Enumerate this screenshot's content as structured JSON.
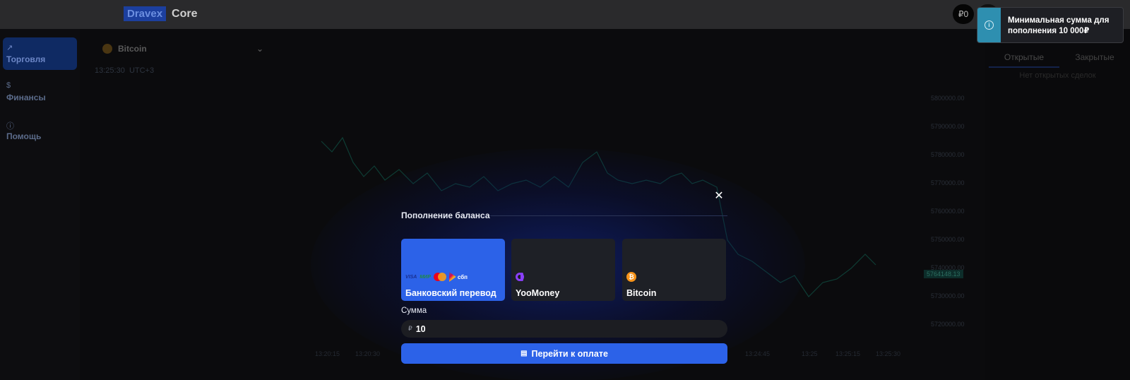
{
  "app": {
    "logo_mark": "Dravex",
    "logo_name": "Core",
    "balance": "₽0"
  },
  "sidebar": {
    "items": [
      {
        "label": "Торговля",
        "icon": "chart-line-icon",
        "active": true
      },
      {
        "label": "Финансы",
        "icon": "dollar-icon",
        "active": false
      },
      {
        "label": "Помощь",
        "icon": "info-icon",
        "active": false
      }
    ]
  },
  "chart_header": {
    "asset": "Bitcoin",
    "time": "13:25:30",
    "timezone": "UTC+3"
  },
  "chart": {
    "price_tag": "5764148.13",
    "y_ticks": [
      "5800000.00",
      "5790000.00",
      "5780000.00",
      "5770000.00",
      "5760000.00",
      "5750000.00",
      "5740000.00",
      "5730000.00",
      "5720000.00"
    ],
    "x_ticks": [
      "13:20:15",
      "13:20:30",
      "13:24:45",
      "13:25",
      "13:25:15",
      "13:25:30"
    ]
  },
  "right_panel": {
    "tabs": [
      "Открытые",
      "Закрытые"
    ],
    "empty_text": "Нет открытых сделок"
  },
  "modal": {
    "title": "Пополнение баланса",
    "close_icon": "close-icon",
    "methods": [
      {
        "label": "Банковский перевод",
        "active": true,
        "logos": [
          "VISA",
          "МИР",
          "mastercard",
          "сбп"
        ]
      },
      {
        "label": "YooMoney",
        "active": false,
        "logos": [
          "yoomoney"
        ]
      },
      {
        "label": "Bitcoin",
        "active": false,
        "logos": [
          "bitcoin"
        ]
      }
    ],
    "amount_label": "Сумма",
    "currency_symbol": "₽",
    "amount_value": "10",
    "submit_label": "Перейти к оплате",
    "submit_icon": "wallet-icon"
  },
  "toast": {
    "message": "Минимальная сумма для пополнения 10 000₽",
    "icon": "info-icon",
    "accent": "#2e8fb0"
  },
  "colors": {
    "primary": "#2c62e8",
    "card": "#1e2026",
    "background": "#0b0b0d"
  }
}
